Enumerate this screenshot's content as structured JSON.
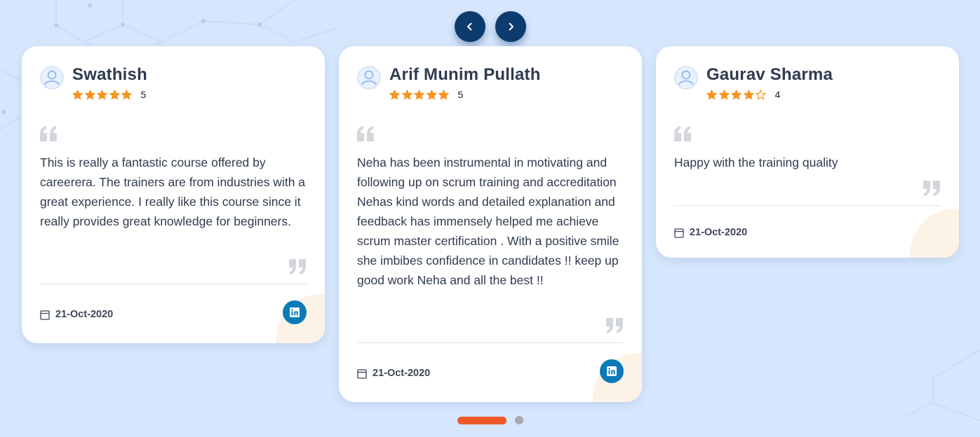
{
  "carousel": {
    "prev_icon": "chevron-left-icon",
    "next_icon": "chevron-right-icon"
  },
  "colors": {
    "background": "#d6e6fc",
    "nav_button": "#0d3b6e",
    "star": "#f7931e",
    "active_dot": "#f0582a",
    "inactive_dot": "#a7a9ac",
    "linkedin": "#0a7bb8"
  },
  "testimonials": [
    {
      "name": "Swathish",
      "rating": 5,
      "rating_label": "5",
      "review": "This is really a fantastic course offered by careerera. The trainers are from industries with a great experience. I really like this course since it really provides great knowledge for beginners.",
      "date": "21-Oct-2020",
      "has_linkedin": true
    },
    {
      "name": "Arif Munim Pullath",
      "rating": 5,
      "rating_label": "5",
      "review": "Neha has been instrumental in motivating and following up on scrum training and accreditation  Nehas kind words and detailed explanation and feedback has immensely helped me achieve scrum master certification . With a positive smile she imbibes confidence in candidates !! keep up good work Neha and all the best !!",
      "date": "21-Oct-2020",
      "has_linkedin": true
    },
    {
      "name": "Gaurav Sharma",
      "rating": 4,
      "rating_label": "4",
      "review": "Happy with the training quality",
      "date": "21-Oct-2020",
      "has_linkedin": false
    }
  ],
  "pagination": {
    "pages": 2,
    "active": 1
  }
}
